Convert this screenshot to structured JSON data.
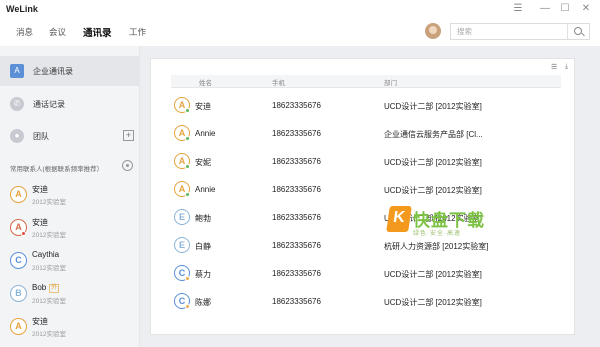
{
  "app": {
    "title": "WeLink"
  },
  "window_controls": {
    "menu": "☰",
    "minimize": "—",
    "maximize": "☐",
    "close": "✕"
  },
  "nav": {
    "tabs": [
      {
        "label": "消息"
      },
      {
        "label": "会议"
      },
      {
        "label": "通讯录",
        "active": true
      },
      {
        "label": "工作"
      }
    ]
  },
  "search": {
    "placeholder": "搜索"
  },
  "sidebar": {
    "items": [
      {
        "label": "企业通讯录",
        "icon": "A",
        "active": true
      },
      {
        "label": "通话记录",
        "icon": "phone"
      },
      {
        "label": "团队",
        "icon": "team"
      }
    ],
    "section_label": "常用联系人(根据联系频率推荐）",
    "contacts": [
      {
        "name": "安迪",
        "sub": "2012实验室",
        "letter": "A",
        "color": "#e6a23c"
      },
      {
        "name": "安迪",
        "sub": "2012实验室",
        "letter": "A",
        "color": "#d4694a"
      },
      {
        "name": "Caythia",
        "sub": "2012实验室",
        "letter": "C",
        "color": "#5a8fd8"
      },
      {
        "name": "Bob",
        "sub": "2012实验室",
        "letter": "B",
        "color": "#8ab4d8",
        "tag": "外"
      },
      {
        "name": "安迪",
        "sub": "2012实验室",
        "letter": "A",
        "color": "#e6a23c"
      }
    ]
  },
  "table": {
    "columns": [
      "姓名",
      "手机",
      "部门"
    ],
    "rows": [
      {
        "name": "安迪",
        "phone": "18623335676",
        "dept": "UCD设计二部 [2012实验室]",
        "letter": "A",
        "color": "#e6a23c",
        "dot": "#5cb85c"
      },
      {
        "name": "Annie",
        "phone": "18623335676",
        "dept": "企业通信云服务产品部 [Cl...",
        "letter": "A",
        "color": "#e6a23c",
        "dot": "#5cb85c"
      },
      {
        "name": "安妮",
        "phone": "18623335676",
        "dept": "UCD设计二部 [2012实验室]",
        "letter": "A",
        "color": "#e6a23c",
        "dot": "#5cb85c"
      },
      {
        "name": "Annie",
        "phone": "18623335676",
        "dept": "UCD设计二部 [2012实验室]",
        "letter": "A",
        "color": "#e6a23c",
        "dot": "#5cb85c"
      },
      {
        "name": "鲍勃",
        "phone": "18623335676",
        "dept": "UCD设计二部 [2012实验室]",
        "letter": "E",
        "color": "#8ab4d8",
        "dot": ""
      },
      {
        "name": "白静",
        "phone": "18623335676",
        "dept": "杭研人力资源部 [2012实验室]",
        "letter": "E",
        "color": "#8ab4d8",
        "dot": ""
      },
      {
        "name": "蔡力",
        "phone": "18623335676",
        "dept": "UCD设计二部 [2012实验室]",
        "letter": "C",
        "color": "#5a8fd8",
        "dot": "#f0ad4e"
      },
      {
        "name": "陈娜",
        "phone": "18623335676",
        "dept": "UCD设计二部 [2012实验室]",
        "letter": "C",
        "color": "#5a8fd8",
        "dot": "#f0ad4e"
      }
    ]
  },
  "watermark": {
    "main": "快盘下载",
    "sub": "绿色·安全·高速"
  }
}
